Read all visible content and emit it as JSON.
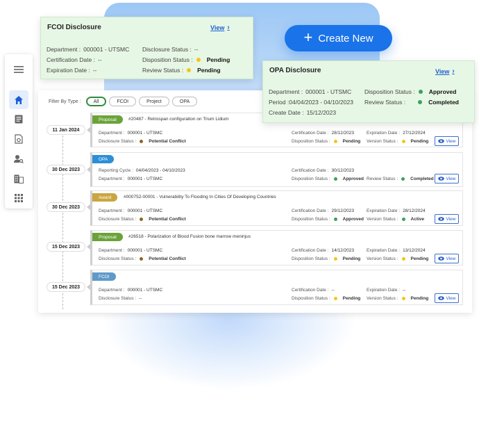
{
  "create_button": {
    "label": "Create New"
  },
  "sidebar": {
    "items": [
      {
        "icon": "menu-icon"
      },
      {
        "icon": "home-icon",
        "active": true
      },
      {
        "icon": "document-icon"
      },
      {
        "icon": "file-settings-icon"
      },
      {
        "icon": "user-search-icon"
      },
      {
        "icon": "building-icon"
      },
      {
        "icon": "apps-grid-icon"
      }
    ]
  },
  "filter": {
    "label": "Filter By Type :",
    "chips": [
      "All",
      "FCOI",
      "Project",
      "OPA"
    ],
    "active": "All"
  },
  "colors": {
    "pending": "#f5c518",
    "approved": "#3aa35b",
    "conflict": "#8a6a1a",
    "proposal_tag": "#6ba33a",
    "opa_tag": "#2d8fd6",
    "award_tag": "#c9a640",
    "fcoi_tag": "#5f9ac9",
    "accent": "#1a73e8"
  },
  "records": [
    {
      "date": "11 Jan 2024",
      "tag": "Proposal",
      "title": "#20487 - Retrospan configuration on Trium Lidium",
      "fields": {
        "department_label": "Department :",
        "department": "000001 - UTSMC",
        "disclosure_status_label": "Disclosure Status :",
        "disclosure_status": "Potential Conflict",
        "certification_label": "Certification Date :",
        "certification": "28/12/2023",
        "disposition_label": "Disposition Status :",
        "disposition": "Pending",
        "expiration_label": "Expiration Date :",
        "expiration": "27/12/2024",
        "version_label": "Version Status :",
        "version": "Pending"
      },
      "view_label": "View"
    },
    {
      "date": "30 Dec 2023",
      "tag": "OPA",
      "title": "",
      "fields": {
        "reporting_label": "Reporting Cycle :",
        "reporting": "04/04/2023 - 04/10/2023",
        "department_label": "Department :",
        "department": "000001 - UTSMC",
        "certification_label": "Certification Date :",
        "certification": "30/12/2023",
        "disposition_label": "Disposition Status :",
        "disposition": "Approved",
        "review_label": "Review Status :",
        "review": "Completed"
      },
      "view_label": "View"
    },
    {
      "date": "30 Dec 2023",
      "tag": "Award",
      "title": "#000752-00001 - Vulnerability To Flooding In Cities Of Developing Countries",
      "fields": {
        "department_label": "Department :",
        "department": "000001 - UTSMC",
        "disclosure_status_label": "Disclosure Status :",
        "disclosure_status": "Potential Conflict",
        "certification_label": "Certification Date :",
        "certification": "29/12/2023",
        "disposition_label": "Disposition Status :",
        "disposition": "Approved",
        "expiration_label": "Expiration Date :",
        "expiration": "28/12/2024",
        "version_label": "Version Status :",
        "version": "Active"
      },
      "view_label": "View"
    },
    {
      "date": "15 Dec 2023",
      "tag": "Proposal",
      "title": "#26518 - Polarization of Blood Fusion bone marrow meninjus",
      "fields": {
        "department_label": "Department :",
        "department": "000001 - UTSMC",
        "disclosure_status_label": "Disclosure Status :",
        "disclosure_status": "Potential Conflict",
        "certification_label": "Certification Date :",
        "certification": "14/12/2023",
        "disposition_label": "Disposition Status :",
        "disposition": "Pending",
        "expiration_label": "Expiration Date :",
        "expiration": "13/12/2024",
        "version_label": "Version Status :",
        "version": "Pending"
      },
      "view_label": "View"
    },
    {
      "date": "15 Dec 2023",
      "tag": "FCOI",
      "title": "",
      "fields": {
        "department_label": "Department :",
        "department": "000001 - UTSMC",
        "disclosure_status_label": "Disclosure Status :",
        "disclosure_status": "--",
        "certification_label": "Certification Date :",
        "certification": "--",
        "disposition_label": "Disposition Status :",
        "disposition": "Pending",
        "expiration_label": "Expiration Date :",
        "expiration": "--",
        "version_label": "Version Status :",
        "version": "Pending"
      },
      "view_label": "View"
    }
  ],
  "fcoi_popup": {
    "title": "FCOI Disclosure",
    "view": "View",
    "department_label": "Department :",
    "department": "000001 - UTSMC",
    "certification_label": "Certification Date :",
    "certification": "--",
    "expiration_label": "Expiration Date :",
    "expiration": "--",
    "disclosure_label": "Disclosure Status :",
    "disclosure": "--",
    "disposition_label": "Disposition Status :",
    "disposition": "Pending",
    "review_label": "Review Status :",
    "review": "Pending"
  },
  "opa_popup": {
    "title": "OPA Disclosure",
    "view": "View",
    "department_label": "Department :",
    "department": "000001 - UTSMC",
    "period_label": "Period :",
    "period": "04/04/2023 - 04/10/2023",
    "create_label": "Create Date :",
    "create": "15/12/2023",
    "disposition_label": "Disposition Status :",
    "disposition": "Approved",
    "review_label": "Review Status :",
    "review": "Completed"
  }
}
